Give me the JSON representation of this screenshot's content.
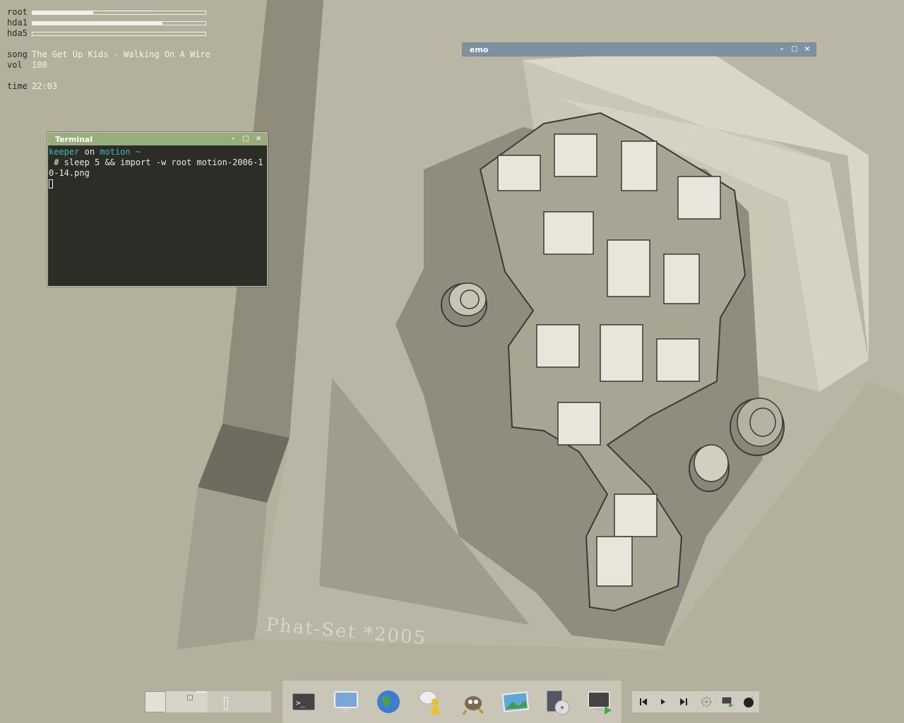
{
  "conky": {
    "bars": [
      {
        "label": "root",
        "fill": 0.35
      },
      {
        "label": "hda1",
        "fill": 0.75
      },
      {
        "label": "hda5",
        "fill": 0.0
      }
    ],
    "song_label": "song",
    "song_value": "The Get Up Kids - Walking On A Wire",
    "vol_label": "vol",
    "vol_value": "100",
    "time_label": "time",
    "time_value": "22:03"
  },
  "terminal": {
    "title": "Terminal",
    "user": "keeper",
    "on_word": "on",
    "host": "motion",
    "tilde": "~",
    "command": " # sleep 5 && import -w root motion-2006-10-14.png"
  },
  "emo_window": {
    "title": "emo"
  },
  "window_controls": {
    "minimize": "–",
    "maximize": "□",
    "close": "×"
  },
  "wallpaper": {
    "watermark": "Phat-Set *2005"
  },
  "dock": {
    "items": [
      {
        "icon": "terminal-icon"
      },
      {
        "icon": "computer-icon"
      },
      {
        "icon": "globe-icon"
      },
      {
        "icon": "chat-icon"
      },
      {
        "icon": "gimp-icon"
      },
      {
        "icon": "image-viewer-icon"
      },
      {
        "icon": "media-player-icon"
      },
      {
        "icon": "remote-desktop-icon"
      }
    ]
  },
  "media_controls": {
    "prev": "previous-track-icon",
    "play": "play-icon",
    "next": "next-track-icon",
    "settings": "gear-icon",
    "screen": "screen-icon",
    "bomb": "bomb-icon"
  },
  "colors": {
    "terminal_title": "#98ad7c",
    "emo_title": "#7b91a4",
    "prompt": "#3bbcb4",
    "desktop": "#b3b09e"
  }
}
